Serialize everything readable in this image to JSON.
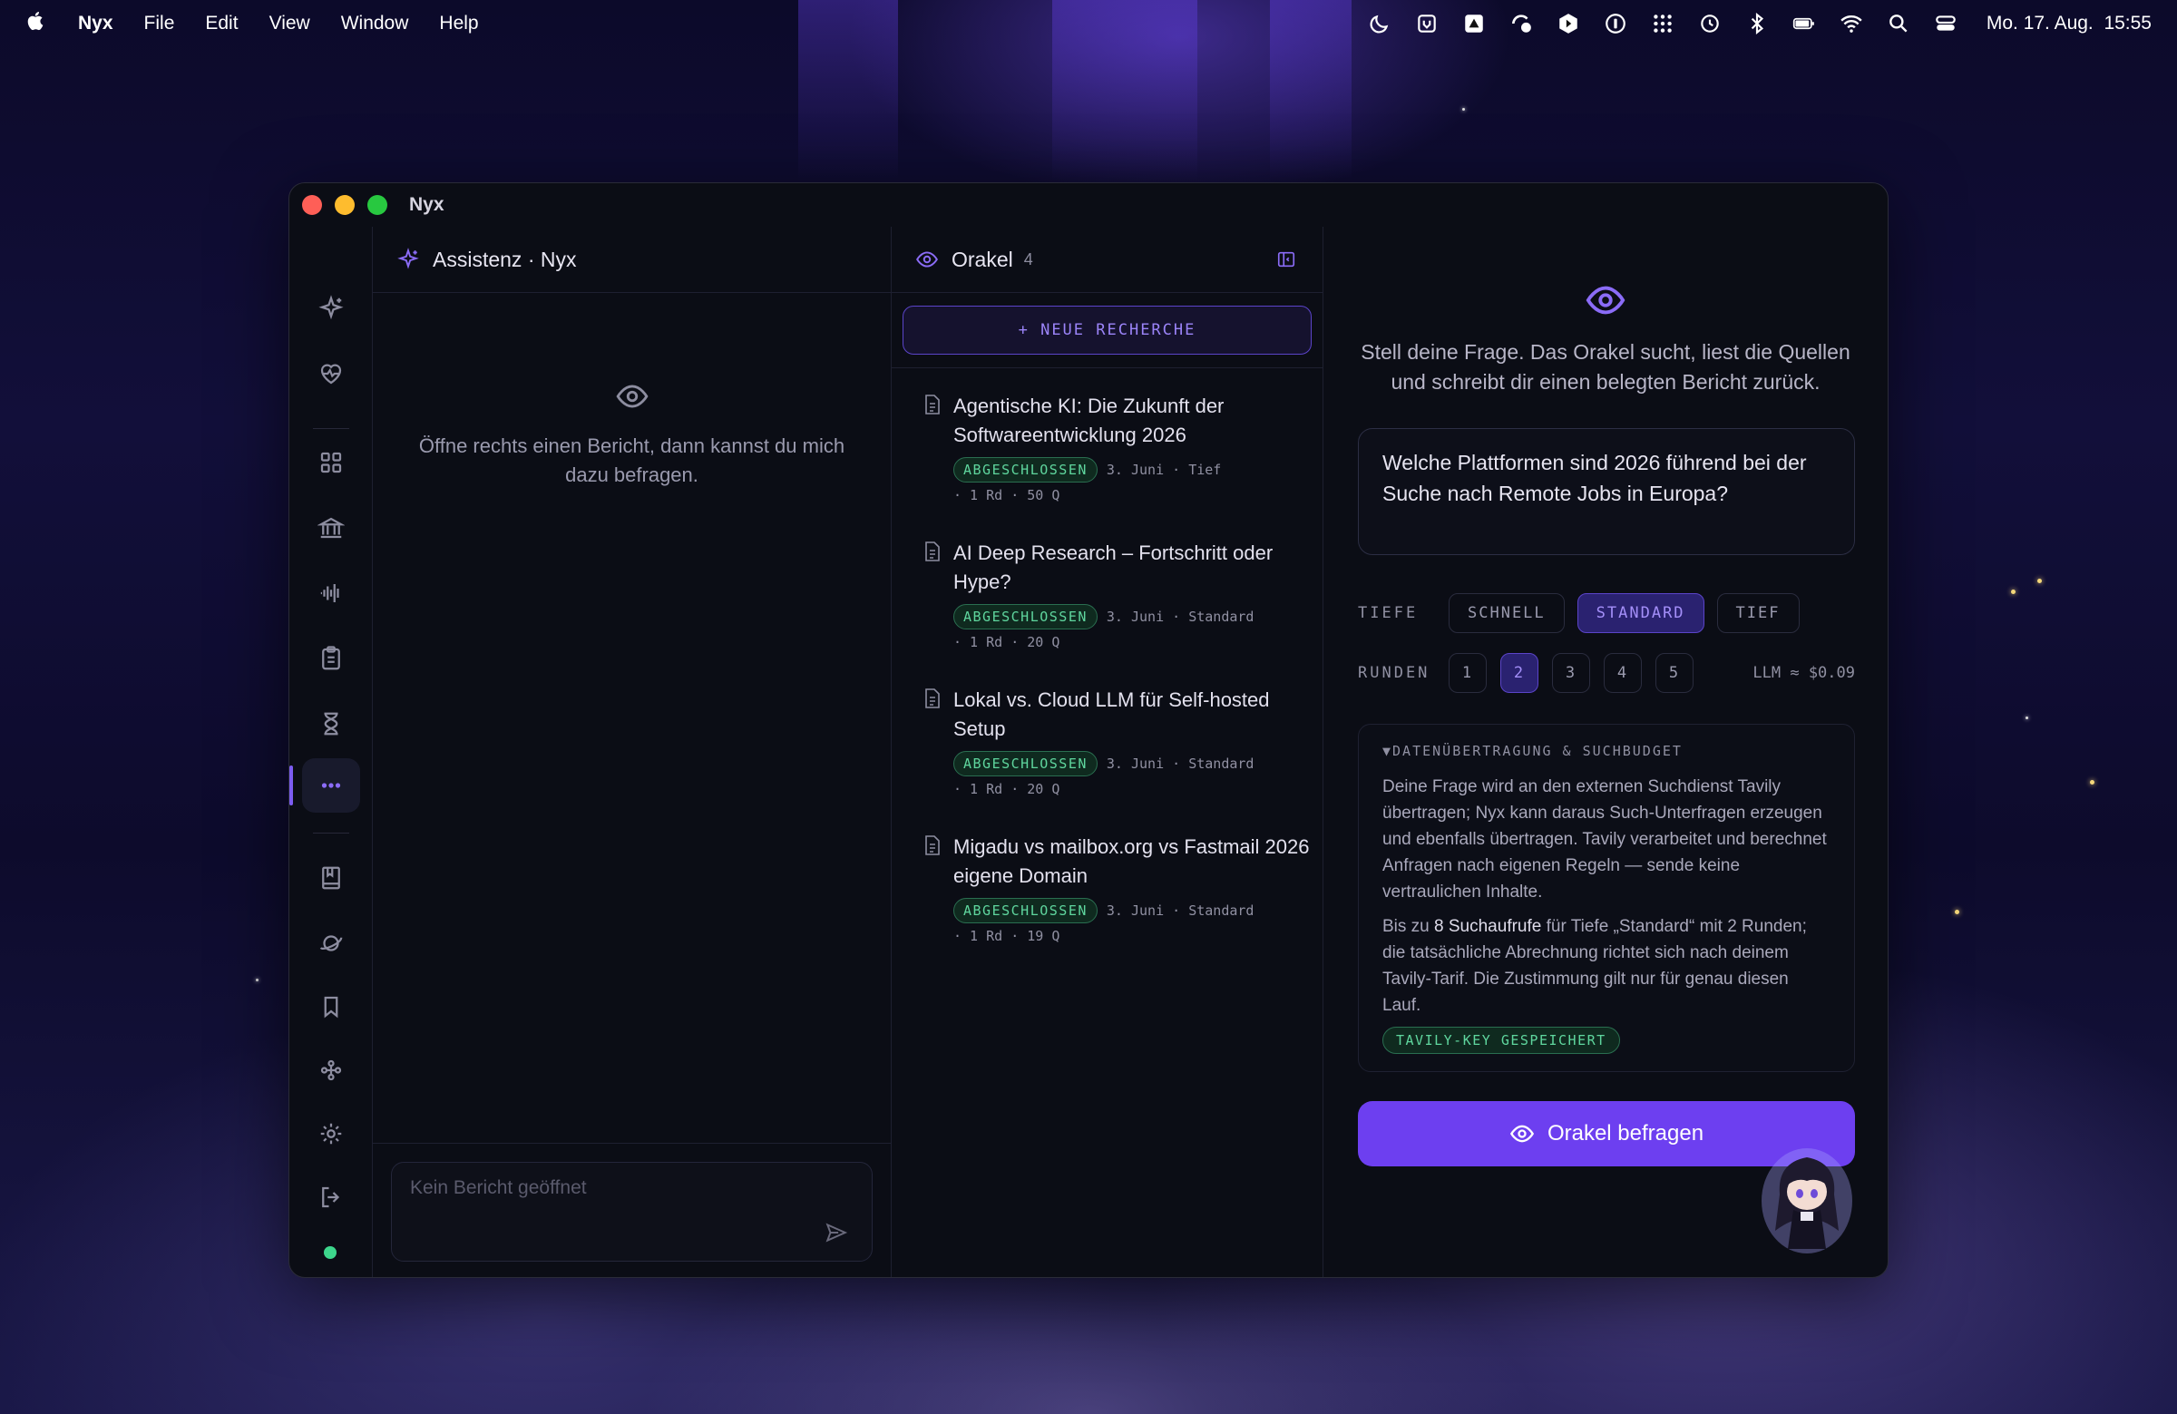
{
  "menubar": {
    "app_name": "Nyx",
    "menus": [
      "File",
      "Edit",
      "View",
      "Window",
      "Help"
    ],
    "datetime": "Mo. 17. Aug.  15:55"
  },
  "window": {
    "title": "Nyx"
  },
  "assistant": {
    "title": "Assistenz · Nyx",
    "empty_text": "Öffne rechts einen Bericht, dann kannst du mich dazu befragen.",
    "input_placeholder": "Kein Bericht geöffnet"
  },
  "oracle_list": {
    "title": "Orakel",
    "count": "4",
    "new_button": "+ NEUE RECHERCHE",
    "reports": [
      {
        "title": "Agentische KI: Die Zukunft der Softwareentwicklung 2026",
        "status": "ABGESCHLOSSEN",
        "meta1": "3. Juni · Tief",
        "meta2": "· 1 Rd · 50 Q"
      },
      {
        "title": "AI Deep Research – Fortschritt oder Hype?",
        "status": "ABGESCHLOSSEN",
        "meta1": "3. Juni · Standard",
        "meta2": "· 1 Rd · 20 Q"
      },
      {
        "title": "Lokal vs. Cloud LLM für Self-hosted Setup",
        "status": "ABGESCHLOSSEN",
        "meta1": "3. Juni · Standard",
        "meta2": "· 1 Rd · 20 Q"
      },
      {
        "title": "Migadu vs mailbox.org vs Fastmail 2026 eigene Domain",
        "status": "ABGESCHLOSSEN",
        "meta1": "3. Juni · Standard",
        "meta2": "· 1 Rd · 19 Q"
      }
    ]
  },
  "oracle_form": {
    "intro": "Stell deine Frage. Das Orakel sucht, liest die Quellen und schreibt dir einen belegten Bericht zurück.",
    "question": "Welche Plattformen sind 2026 führend bei der Suche nach Remote Jobs in Europa?",
    "depth_label": "TIEFE",
    "depth_options": [
      "SCHNELL",
      "STANDARD",
      "TIEF"
    ],
    "depth_selected": "STANDARD",
    "rounds_label": "RUNDEN",
    "rounds_options": [
      "1",
      "2",
      "3",
      "4",
      "5"
    ],
    "rounds_selected": "2",
    "cost": "LLM ≈ $0.09",
    "consent_title": "▼DATENÜBERTRAGUNG & SUCHBUDGET",
    "consent_p1": "Deine Frage wird an den externen Suchdienst Tavily übertragen; Nyx kann daraus Such-Unterfragen erzeugen und ebenfalls übertragen. Tavily verarbeitet und berechnet Anfragen nach eigenen Regeln — sende keine vertraulichen Inhalte.",
    "consent_p2_pre": "Bis zu ",
    "consent_p2_bold": "8 Suchaufrufe",
    "consent_p2_post": " für Tiefe „Standard“ mit 2 Runden; die tatsächliche Abrechnung richtet sich nach deinem Tavily-Tarif. Die Zustimmung gilt nur für genau diesen Lauf.",
    "key_badge": "TAVILY-KEY GESPEICHERT",
    "submit": "Orakel befragen"
  },
  "colors": {
    "accent": "#6d3ff0",
    "accent_light": "#8b6cf7",
    "success": "#5fd69e",
    "status_online": "#3dd68c"
  }
}
